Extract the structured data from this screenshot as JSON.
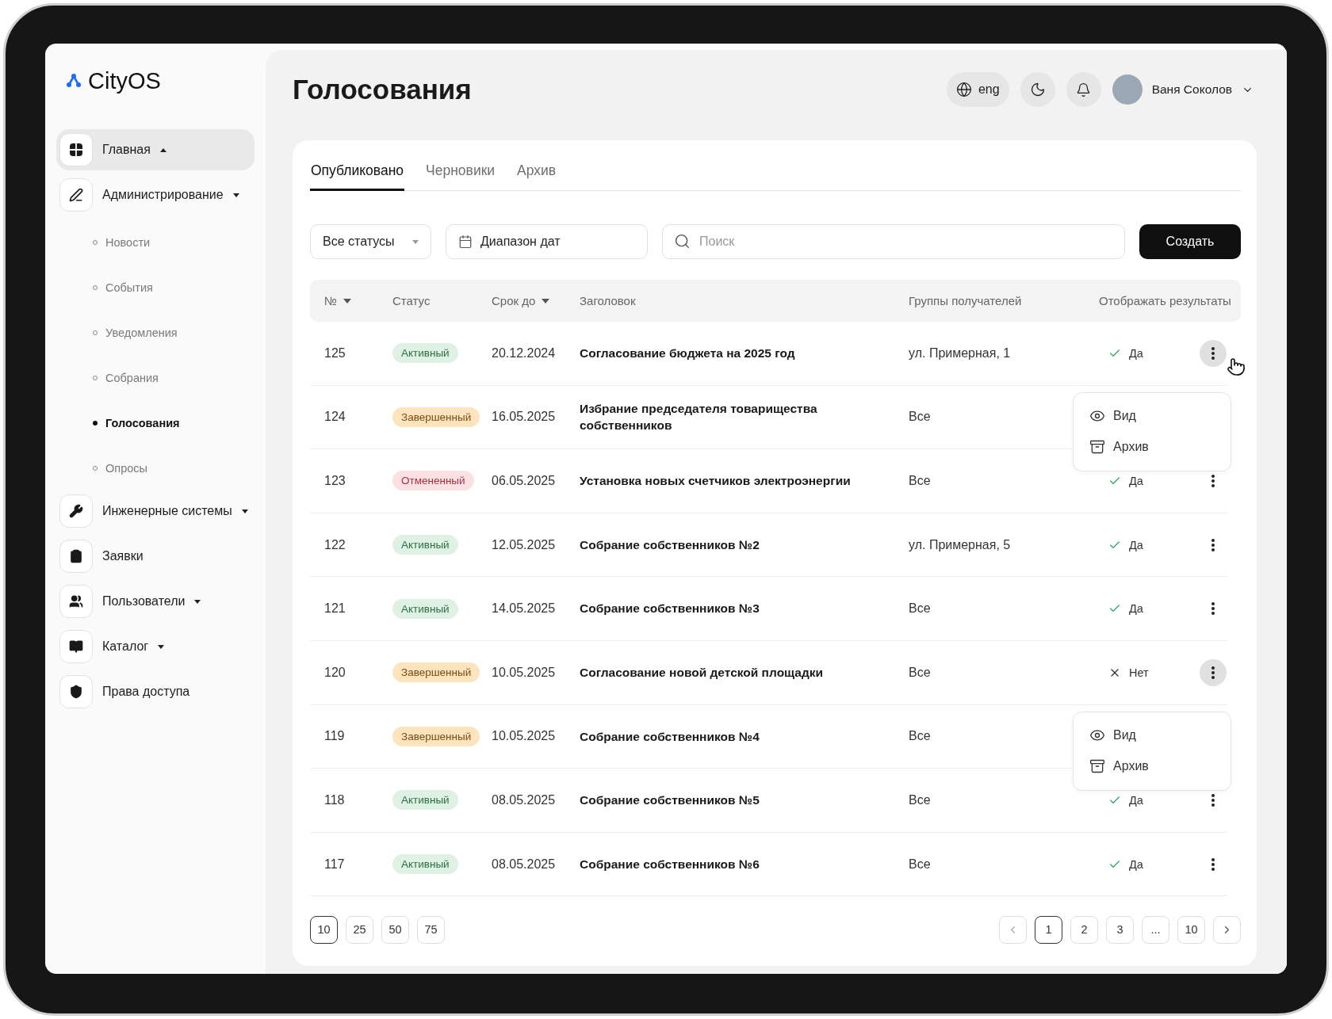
{
  "sidebar": {
    "logo": "CityOS",
    "items": [
      {
        "label": "Главная",
        "selected": true,
        "expanded": true
      },
      {
        "label": "Администрирование",
        "selected": false,
        "expanded": false,
        "children": [
          {
            "label": "Новости",
            "selected": false
          },
          {
            "label": "События",
            "selected": false
          },
          {
            "label": "Уведомления",
            "selected": false
          },
          {
            "label": "Собрания",
            "selected": false
          },
          {
            "label": "Голосования",
            "selected": true
          },
          {
            "label": "Опросы",
            "selected": false
          }
        ]
      },
      {
        "label": "Инженерные системы",
        "selected": false,
        "expanded": false
      },
      {
        "label": "Заявки",
        "selected": false
      },
      {
        "label": "Пользователи",
        "selected": false,
        "expanded": false
      },
      {
        "label": "Каталог",
        "selected": false,
        "expanded": false
      },
      {
        "label": "Права доступа",
        "selected": false
      }
    ]
  },
  "header": {
    "title": "Голосования",
    "language": "eng",
    "user": "Ваня Соколов"
  },
  "tabs": [
    {
      "label": "Опубликовано",
      "selected": true
    },
    {
      "label": "Черновики",
      "selected": false
    },
    {
      "label": "Архив",
      "selected": false
    }
  ],
  "filters": {
    "status": "Все статусы",
    "dates": "Диапазон дат",
    "search_placeholder": "Поиск",
    "create": "Создать"
  },
  "table": {
    "columns": [
      {
        "label": "№",
        "sortable": true
      },
      {
        "label": "Статус",
        "sortable": false
      },
      {
        "label": "Срок до",
        "sortable": true
      },
      {
        "label": "Заголовок",
        "sortable": false
      },
      {
        "label": "Группы получателей",
        "sortable": false
      },
      {
        "label": "Отображать результаты",
        "sortable": false
      }
    ],
    "rows": [
      {
        "id": "125",
        "status": "Активный",
        "kind": "active",
        "due": "20.12.2024",
        "title": "Согласование бюджета на 2025 год",
        "groups": "ул. Примерная, 1",
        "results": {
          "label": "Да",
          "shown": true
        },
        "menu_open": true,
        "menu": [
          {
            "label": "Вид",
            "kind": "view"
          },
          {
            "label": "Архив",
            "kind": "archive"
          }
        ]
      },
      {
        "id": "124",
        "status": "Завершенный",
        "kind": "done",
        "due": "16.05.2025",
        "title": "Избрание председателя товарищества собственников",
        "groups": "Все",
        "menu_open": false
      },
      {
        "id": "123",
        "status": "Отмененный",
        "kind": "cancelled",
        "due": "06.05.2025",
        "title": "Установка новых счетчиков электроэнергии",
        "groups": "Все",
        "results": {
          "label": "Да",
          "shown": true
        },
        "menu_open": false
      },
      {
        "id": "122",
        "status": "Активный",
        "kind": "active",
        "due": "12.05.2025",
        "title": "Собрание собственников №2",
        "groups": "ул. Примерная, 5",
        "results": {
          "label": "Да",
          "shown": true
        },
        "menu_open": false
      },
      {
        "id": "121",
        "status": "Активный",
        "kind": "active",
        "due": "14.05.2025",
        "title": "Собрание собственников №3",
        "groups": "Все",
        "results": {
          "label": "Да",
          "shown": true
        },
        "menu_open": false
      },
      {
        "id": "120",
        "status": "Завершенный",
        "kind": "done",
        "due": "10.05.2025",
        "title": "Согласование новой детской площадки",
        "groups": "Все",
        "results": {
          "label": "Нет",
          "shown": false
        },
        "menu_open": true,
        "menu": [
          {
            "label": "Вид",
            "kind": "view"
          },
          {
            "label": "Архив",
            "kind": "archive"
          }
        ]
      },
      {
        "id": "119",
        "status": "Завершенный",
        "kind": "done",
        "due": "10.05.2025",
        "title": "Собрание собственников №4",
        "groups": "Все",
        "menu_open": false
      },
      {
        "id": "118",
        "status": "Активный",
        "kind": "active",
        "due": "08.05.2025",
        "title": "Собрание собственников №5",
        "groups": "Все",
        "results": {
          "label": "Да",
          "shown": true
        },
        "menu_open": false
      },
      {
        "id": "117",
        "status": "Активный",
        "kind": "active",
        "due": "08.05.2025",
        "title": "Собрание собственников №6",
        "groups": "Все",
        "results": {
          "label": "Да",
          "shown": true
        },
        "menu_open": false
      }
    ]
  },
  "page_sizes": [
    {
      "label": "10",
      "selected": true
    },
    {
      "label": "25",
      "selected": false
    },
    {
      "label": "50",
      "selected": false
    },
    {
      "label": "75",
      "selected": false
    }
  ],
  "pages": [
    {
      "label": "1",
      "selected": true
    },
    {
      "label": "2",
      "selected": false
    },
    {
      "label": "3",
      "selected": false
    },
    {
      "label": "...",
      "selected": false
    },
    {
      "label": "10",
      "selected": false
    }
  ]
}
